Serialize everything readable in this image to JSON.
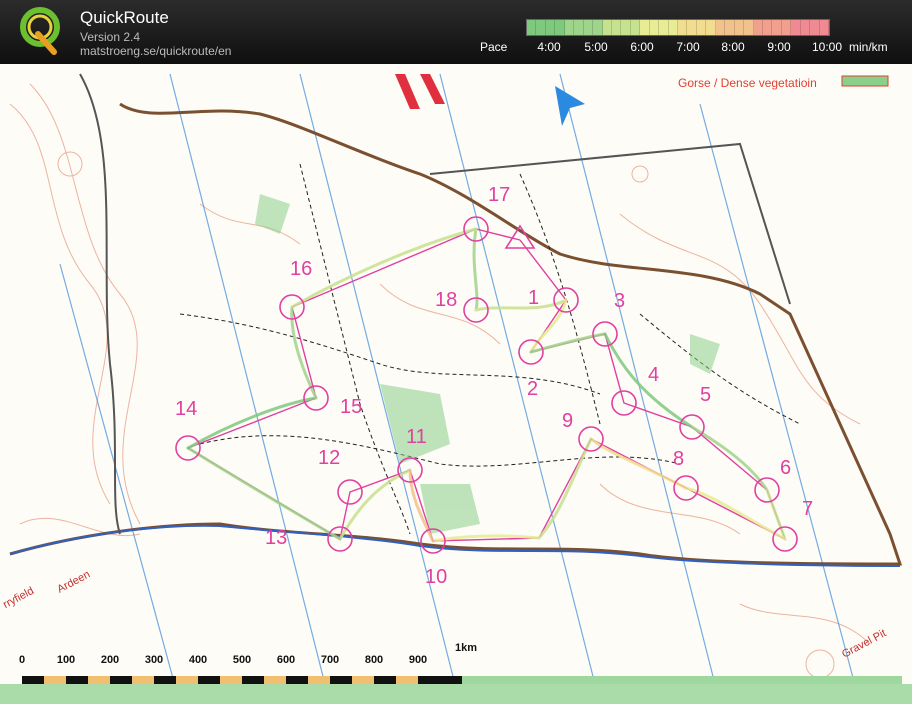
{
  "app": {
    "title": "QuickRoute",
    "version": "Version 2.4",
    "url": "matstroeng.se/quickroute/en"
  },
  "pace": {
    "label": "Pace",
    "ticks": [
      "4:00",
      "5:00",
      "6:00",
      "7:00",
      "8:00",
      "9:00",
      "10:00"
    ],
    "unit": "min/km",
    "colors": [
      "#7fc97f",
      "#9fd58a",
      "#c7e28f",
      "#e7ec95",
      "#f1dc8f",
      "#f2c28d",
      "#f1a08e",
      "#ef8a92"
    ]
  },
  "map": {
    "legend_text": "Gorse / Dense vegetatioin",
    "controls": [
      "1",
      "2",
      "3",
      "4",
      "5",
      "6",
      "7",
      "8",
      "9",
      "10",
      "11",
      "12",
      "13",
      "14",
      "15",
      "16",
      "17",
      "18"
    ],
    "street_names": [
      "rryfield",
      "Ardeen",
      "Gravel Pit"
    ],
    "scale": {
      "labels": [
        "0",
        "100",
        "200",
        "300",
        "400",
        "500",
        "600",
        "700",
        "800",
        "900",
        "1km"
      ]
    }
  }
}
